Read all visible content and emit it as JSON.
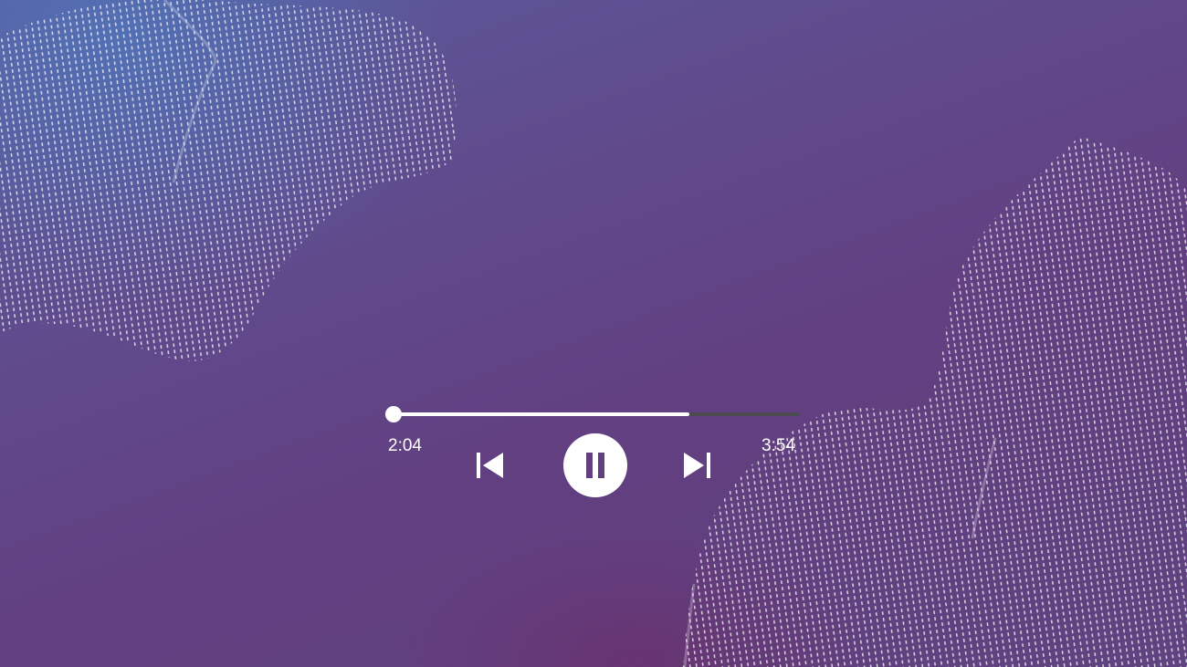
{
  "player": {
    "progress_fraction": 0.727,
    "elapsed": "2:04",
    "total": "3:54",
    "state": "playing",
    "controls": {
      "previous_icon": "skip-previous-icon",
      "play_pause_icon": "pause-icon",
      "next_icon": "skip-next-icon"
    }
  },
  "colors": {
    "track_filled": "#ffffff",
    "track_remaining": "#4b4b4f",
    "controls": "#ffffff",
    "pause_glyph": "#623f80"
  }
}
